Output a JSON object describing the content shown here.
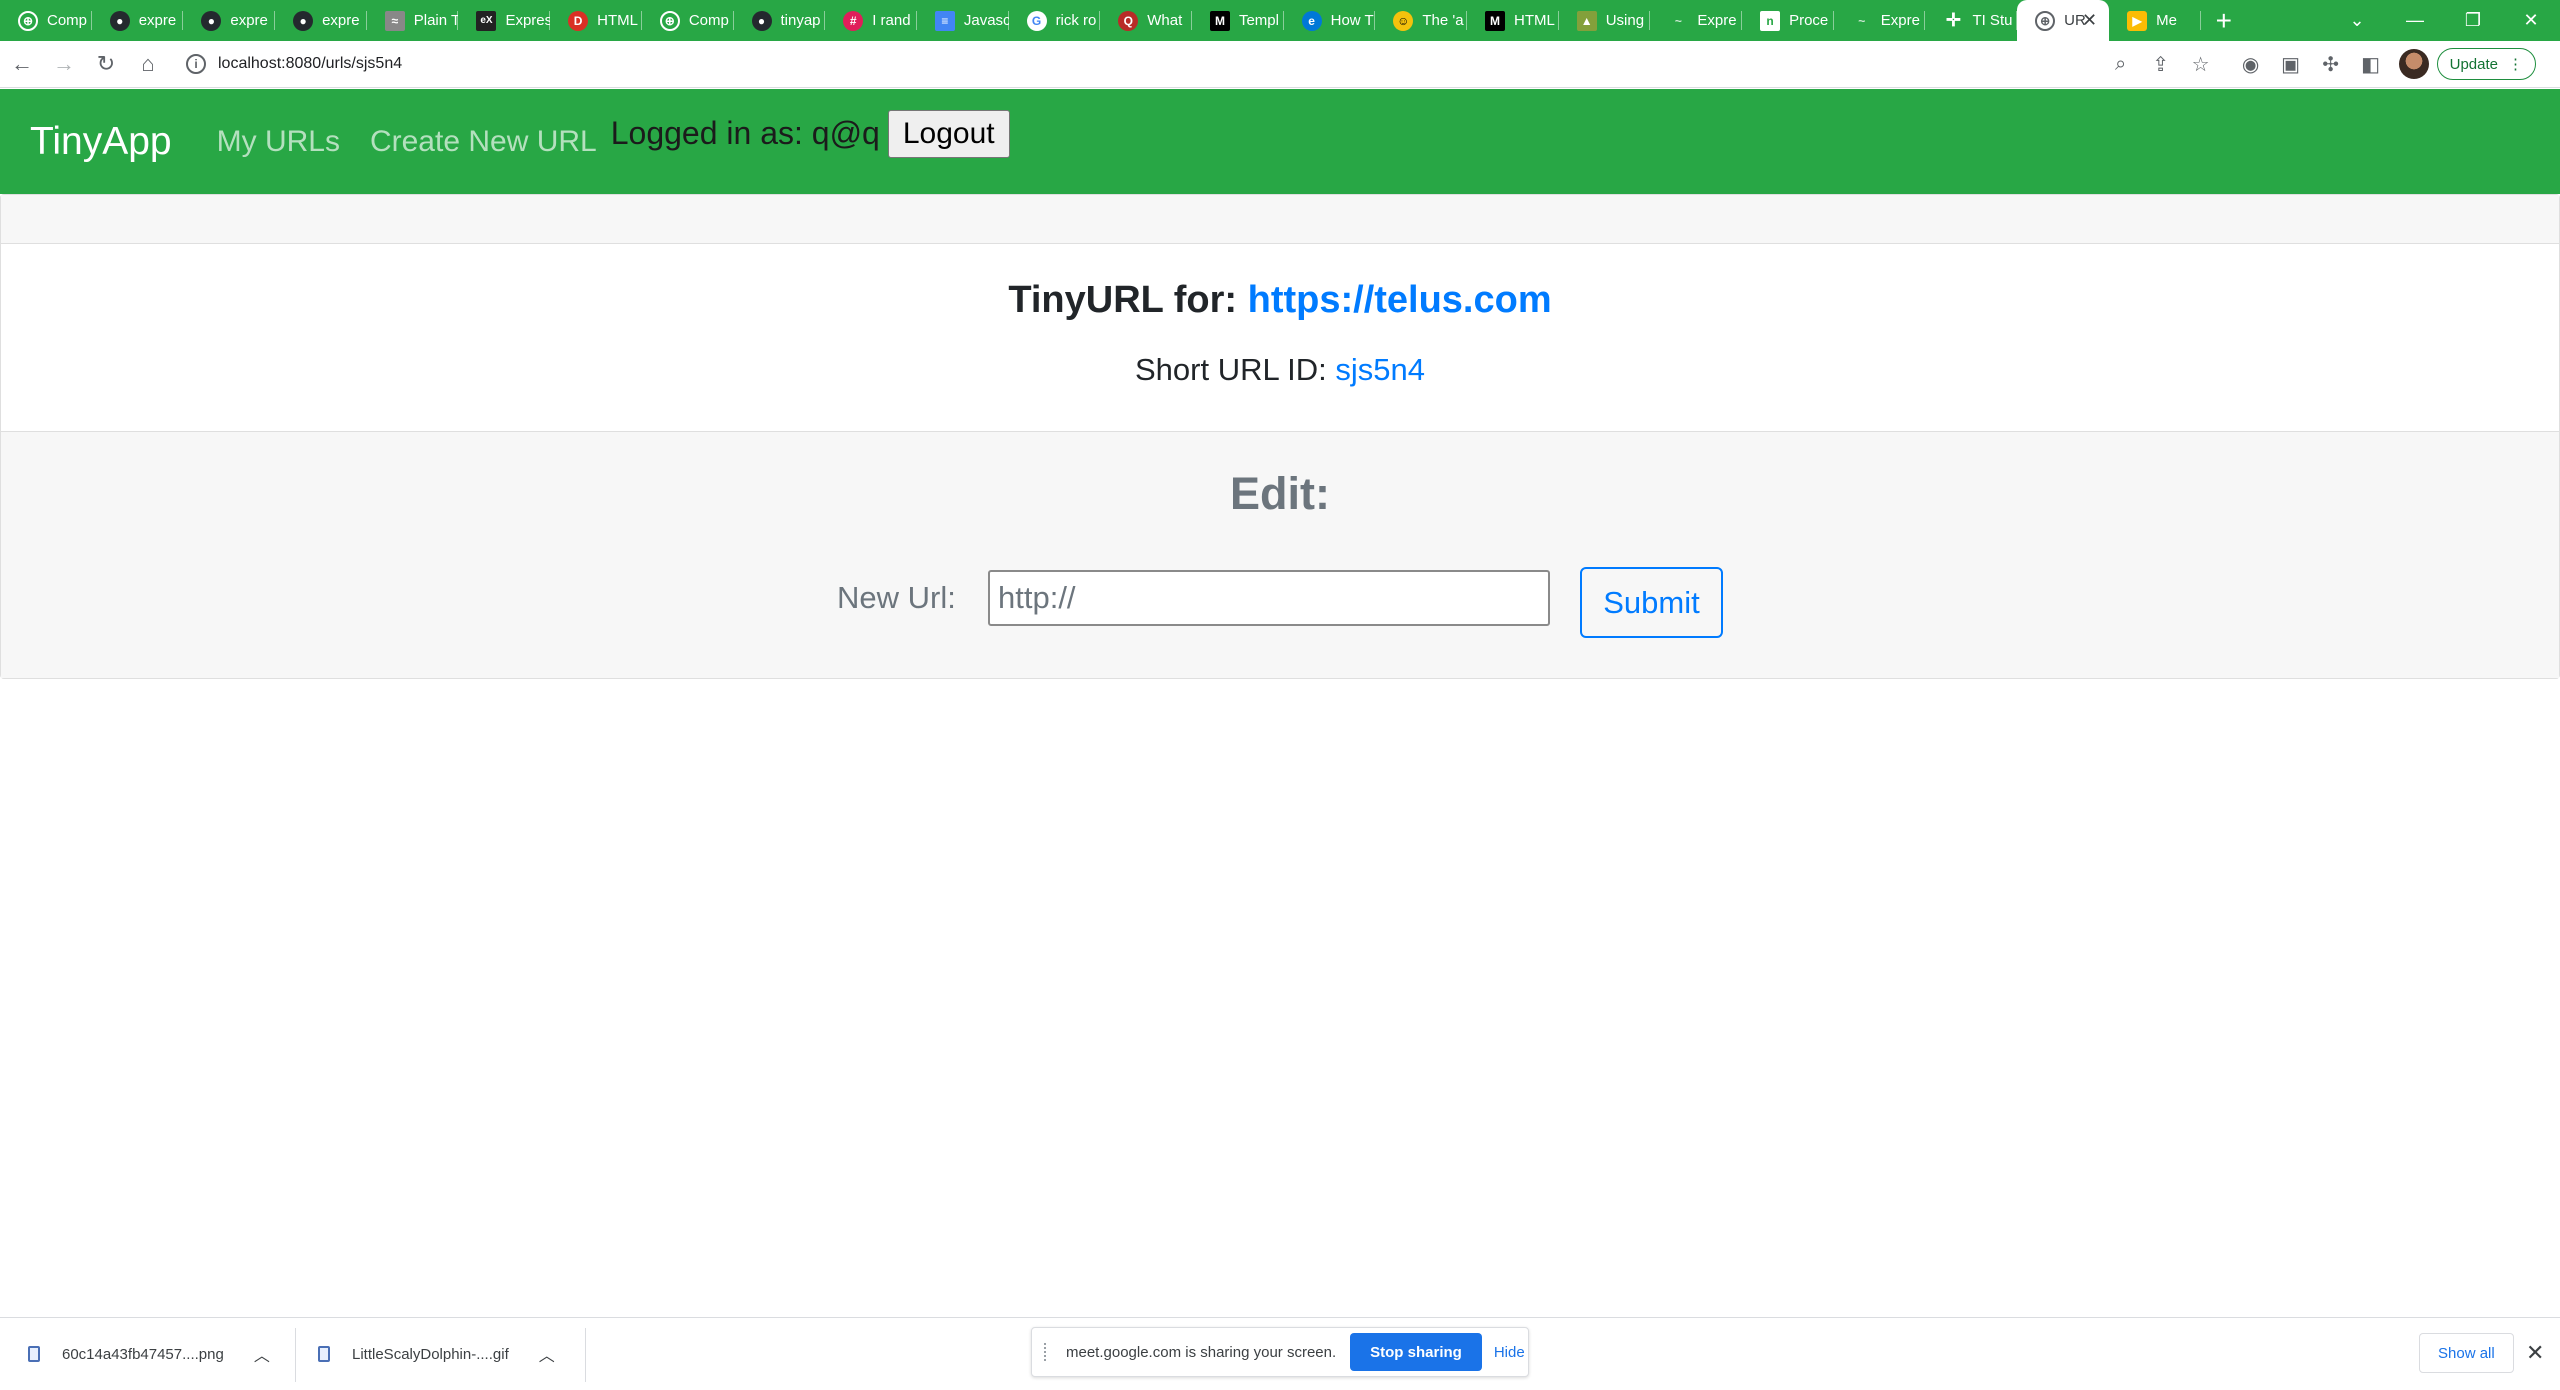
{
  "browser": {
    "tabs": [
      {
        "title": "Comp",
        "icon": "globe-icon",
        "color": "#28a745"
      },
      {
        "title": "expre",
        "icon": "github-icon",
        "color": "#24292e"
      },
      {
        "title": "expre",
        "icon": "github-icon",
        "color": "#24292e"
      },
      {
        "title": "expre",
        "icon": "github-icon",
        "color": "#24292e"
      },
      {
        "title": "Plain T",
        "icon": "text-icon",
        "color": "#888888"
      },
      {
        "title": "Expres",
        "icon": "express-icon",
        "color": "#222222"
      },
      {
        "title": "HTML",
        "icon": "devdocs-icon",
        "color": "#d93025"
      },
      {
        "title": "Comp",
        "icon": "globe-icon",
        "color": "#28a745"
      },
      {
        "title": "tinyap",
        "icon": "github-icon",
        "color": "#24292e"
      },
      {
        "title": "I rand",
        "icon": "slack-icon",
        "color": "#e01e5a"
      },
      {
        "title": "Javasc",
        "icon": "docs-icon",
        "color": "#4285f4"
      },
      {
        "title": "rick ro",
        "icon": "google-icon",
        "color": "#ffffff"
      },
      {
        "title": "What",
        "icon": "quora-icon",
        "color": "#b92b27"
      },
      {
        "title": "Templ",
        "icon": "medium-icon",
        "color": "#000000"
      },
      {
        "title": "How T",
        "icon": "edge-icon",
        "color": "#0078d7"
      },
      {
        "title": "The 'a",
        "icon": "emoji-icon",
        "color": "#f4c20d"
      },
      {
        "title": "HTML",
        "icon": "medium-icon",
        "color": "#000000"
      },
      {
        "title": "Using",
        "icon": "mdn-icon",
        "color": "#83a03b"
      },
      {
        "title": "Expre",
        "icon": "dash-icon",
        "color": "#28a745"
      },
      {
        "title": "Proce",
        "icon": "nodejs-icon",
        "color": "#ffffff"
      },
      {
        "title": "Expre",
        "icon": "dash-icon",
        "color": "#28a745"
      },
      {
        "title": "TI Stu",
        "icon": "cross-icon",
        "color": "#ffffff"
      },
      {
        "title": "UR",
        "icon": "globe-icon",
        "color": "#5f6368",
        "active": true
      },
      {
        "title": "Me",
        "icon": "meet-icon",
        "color": "#fbbc04"
      }
    ],
    "window_controls": [
      "chevron-down-icon",
      "minimize-icon",
      "restore-icon",
      "close-icon"
    ],
    "address": "localhost:8080/urls/sjs5n4",
    "update_label": "Update"
  },
  "app": {
    "brand": "TinyApp",
    "nav": {
      "my_urls": "My URLs",
      "create_new": "Create New URL"
    },
    "logged_in_text": "Logged in as: q@q",
    "logout_label": "Logout"
  },
  "url_card": {
    "title_prefix": "TinyURL for: ",
    "long_url": "https://telus.com",
    "short_prefix": "Short URL ID: ",
    "short_id": "sjs5n4"
  },
  "edit_form": {
    "heading": "Edit:",
    "label": "New Url:",
    "input_value": "http://",
    "submit_label": "Submit"
  },
  "download_bar": {
    "items": [
      {
        "name": "60c14a43fb47457....png"
      },
      {
        "name": "LittleScalyDolphin-....gif"
      }
    ],
    "share_text": "meet.google.com is sharing your screen.",
    "stop_label": "Stop sharing",
    "hide_label": "Hide",
    "show_all_label": "Show all"
  },
  "colors": {
    "brand_green": "#28a745",
    "link_blue": "#007bff",
    "muted_gray": "#6c757d"
  }
}
